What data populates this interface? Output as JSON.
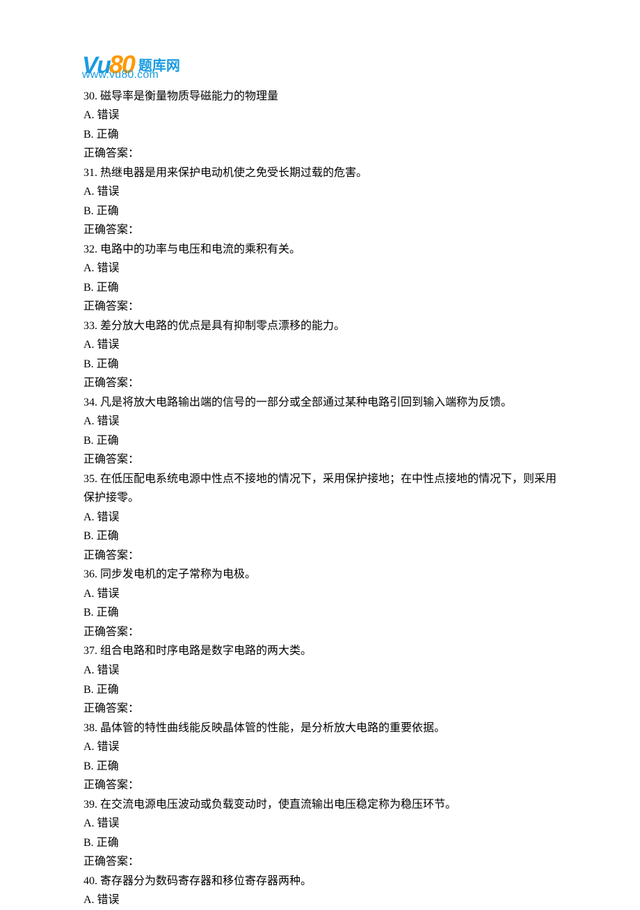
{
  "logo": {
    "brand_vu": "Vu",
    "brand_80": "80",
    "brand_cn": "题库网",
    "url": "www.vu80.com"
  },
  "questions": [
    {
      "num": "30.",
      "text": "磁导率是衡量物质导磁能力的物理量",
      "optA": "A.  错误",
      "optB": "B.  正确",
      "ans": "正确答案："
    },
    {
      "num": "31.",
      "text": "热继电器是用来保护电动机使之免受长期过载的危害。",
      "optA": "A.  错误",
      "optB": "B.  正确",
      "ans": "正确答案："
    },
    {
      "num": "32.",
      "text": "电路中的功率与电压和电流的乘积有关。",
      "optA": "A.  错误",
      "optB": "B.  正确",
      "ans": "正确答案："
    },
    {
      "num": "33.",
      "text": "差分放大电路的优点是具有抑制零点漂移的能力。",
      "optA": "A.  错误",
      "optB": "B.  正确",
      "ans": "正确答案："
    },
    {
      "num": "34.",
      "text": "凡是将放大电路输出端的信号的一部分或全部通过某种电路引回到输入端称为反馈。",
      "optA": "A.  错误",
      "optB": "B.  正确",
      "ans": "正确答案："
    },
    {
      "num": "35.",
      "text": "在低压配电系统电源中性点不接地的情况下，采用保护接地；在中性点接地的情况下，则采用保护接零。",
      "optA": "A.  错误",
      "optB": "B.  正确",
      "ans": "正确答案："
    },
    {
      "num": "36.",
      "text": "同步发电机的定子常称为电极。",
      "optA": "A.  错误",
      "optB": "B.  正确",
      "ans": "正确答案："
    },
    {
      "num": "37.",
      "text": "组合电路和时序电路是数字电路的两大类。",
      "optA": "A.  错误",
      "optB": "B.  正确",
      "ans": "正确答案："
    },
    {
      "num": "38.",
      "text": "晶体管的特性曲线能反映晶体管的性能，是分析放大电路的重要依据。",
      "optA": "A.  错误",
      "optB": "B.  正确",
      "ans": "正确答案："
    },
    {
      "num": "39.",
      "text": "在交流电源电压波动或负载变动时，使直流输出电压稳定称为稳压环节。",
      "optA": "A.  错误",
      "optB": "B.  正确",
      "ans": "正确答案："
    },
    {
      "num": "40.",
      "text": "寄存器分为数码寄存器和移位寄存器两种。",
      "optA": "A.  错误",
      "optB": "",
      "ans": ""
    }
  ]
}
